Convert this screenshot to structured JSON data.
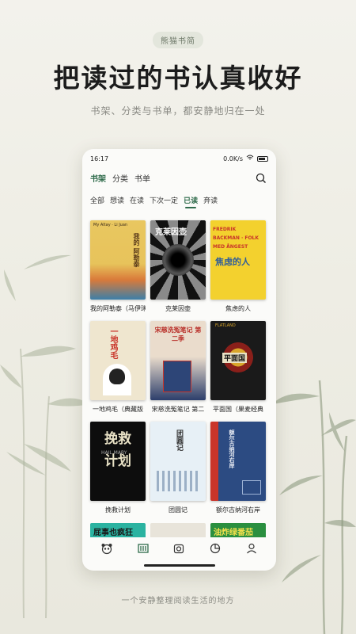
{
  "badge": "熊猫书简",
  "headline": "把读过的书认真收好",
  "subline": "书架、分类与书单，都安静地归在一处",
  "footer": "一个安静整理阅读生活的地方",
  "phone": {
    "status": {
      "time": "16:17",
      "speed": "0.0K/s",
      "battery_icon": "battery-icon"
    },
    "nav_tabs": [
      {
        "label": "书架",
        "active": true
      },
      {
        "label": "分类",
        "active": false
      },
      {
        "label": "书单",
        "active": false
      }
    ],
    "filters": [
      {
        "label": "全部"
      },
      {
        "label": "想读"
      },
      {
        "label": "在读"
      },
      {
        "label": "下次一定"
      },
      {
        "label": "已读",
        "active": true
      },
      {
        "label": "弃读"
      }
    ],
    "books": [
      {
        "title": "我的阿勒泰（马伊琍",
        "cover_text": "我的 阿勒泰",
        "cover_sub": "My Altay · Li Juan",
        "colors": [
          "#e8c35a",
          "#3c7fa8"
        ]
      },
      {
        "title": "克莱因壶",
        "cover_text": "克莱因壶",
        "cover_sub": "",
        "colors": [
          "#111111",
          "#7a7a7a"
        ]
      },
      {
        "title": "焦虑的人",
        "cover_text": "焦虑的人",
        "cover_sub": "FREDRIK BACKMAN · FOLK MED ÅNGEST",
        "colors": [
          "#f3d12e",
          "#2f5d9a"
        ]
      },
      {
        "title": "一地鸡毛（典藏版",
        "cover_text": "一地鸡毛",
        "cover_sub": "",
        "colors": [
          "#efe6cf",
          "#c9352a"
        ]
      },
      {
        "title": "宋慈洗冤笔记 第二",
        "cover_text": "宋慈洗冤笔记 第二季",
        "cover_sub": "",
        "colors": [
          "#e9d9c9",
          "#2c3e6b"
        ]
      },
      {
        "title": "平面国（果麦经典",
        "cover_text": "平面国",
        "cover_sub": "FLATLAND",
        "colors": [
          "#1a1a1a",
          "#d9a62b"
        ]
      },
      {
        "title": "挽救计划",
        "cover_text": "挽救 计划",
        "cover_sub": "HAIL MARY",
        "colors": [
          "#0d0d0d",
          "#e9e2c6"
        ]
      },
      {
        "title": "团圆记",
        "cover_text": "团圆记",
        "cover_sub": "",
        "colors": [
          "#e7f0f6",
          "#6a86a6"
        ]
      },
      {
        "title": "额尔古纳河右岸",
        "cover_text": "额尔古纳河右岸",
        "cover_sub": "",
        "colors": [
          "#2c4b82",
          "#c9352a"
        ]
      }
    ],
    "partial_covers": [
      {
        "text": "屁事也疯狂",
        "colors": [
          "#2bb3a1",
          "#1a1a1a"
        ]
      },
      {
        "text": "",
        "colors": [
          "#e8e4da",
          "#9a3b3b"
        ]
      },
      {
        "text": "油炸绿番茄",
        "colors": [
          "#2a8f3f",
          "#f4e04d"
        ]
      }
    ],
    "bottom_nav": [
      {
        "icon": "panda-icon",
        "active": false
      },
      {
        "icon": "bookshelf-icon",
        "active": true
      },
      {
        "icon": "camera-icon",
        "active": false
      },
      {
        "icon": "pie-chart-icon",
        "active": false
      },
      {
        "icon": "user-icon",
        "active": false
      }
    ],
    "accent": "#2f6b4b"
  }
}
